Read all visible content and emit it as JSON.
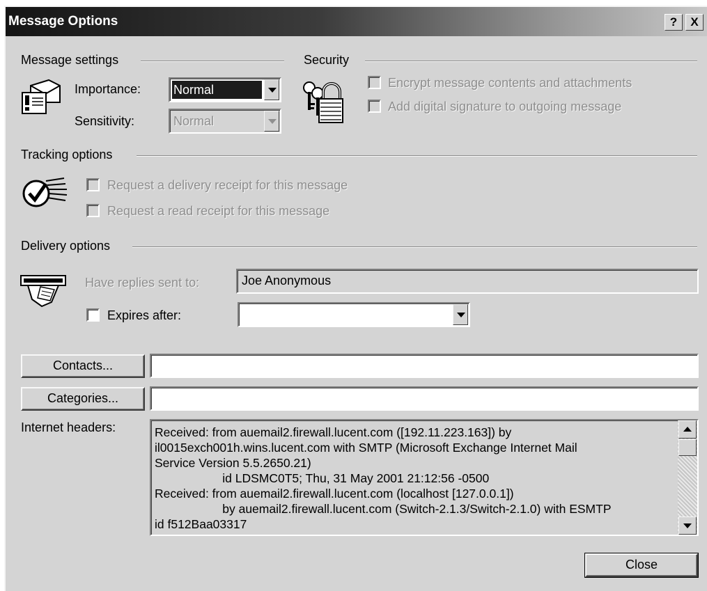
{
  "window": {
    "title": "Message Options",
    "help_label": "?",
    "close_label": "X"
  },
  "message_settings": {
    "group_label": "Message settings",
    "importance_label": "Importance:",
    "importance_value": "Normal",
    "sensitivity_label": "Sensitivity:",
    "sensitivity_value": "Normal"
  },
  "security": {
    "group_label": "Security",
    "encrypt_label": "Encrypt message contents and attachments",
    "signature_label": "Add digital signature to outgoing message"
  },
  "tracking": {
    "group_label": "Tracking options",
    "delivery_receipt_label": "Request a delivery receipt for this message",
    "read_receipt_label": "Request a read receipt for this message"
  },
  "delivery": {
    "group_label": "Delivery options",
    "replies_label": "Have replies sent to:",
    "replies_value": "Joe Anonymous",
    "expires_label": "Expires after:",
    "expires_value": ""
  },
  "contacts": {
    "button_label": "Contacts...",
    "value": ""
  },
  "categories": {
    "button_label": "Categories...",
    "value": ""
  },
  "internet_headers": {
    "label": "Internet headers:",
    "lines": [
      "Received: from auemail2.firewall.lucent.com ([192.11.223.163]) by",
      "il0015exch001h.wins.lucent.com with SMTP (Microsoft Exchange Internet Mail",
      "Service Version 5.5.2650.21)",
      "                    id LDSMC0T5; Thu, 31 May 2001 21:12:56 -0500",
      "Received: from auemail2.firewall.lucent.com (localhost [127.0.0.1])",
      "                    by auemail2.firewall.lucent.com (Switch-2.1.3/Switch-2.1.0) with ESMTP",
      "id f512Baa03317"
    ]
  },
  "footer": {
    "close_label": "Close"
  },
  "icons": {
    "message": "envelope-importance-icon",
    "security": "padlock-keys-icon",
    "tracking": "checkmark-receipt-icon",
    "delivery": "hand-letter-icon"
  }
}
